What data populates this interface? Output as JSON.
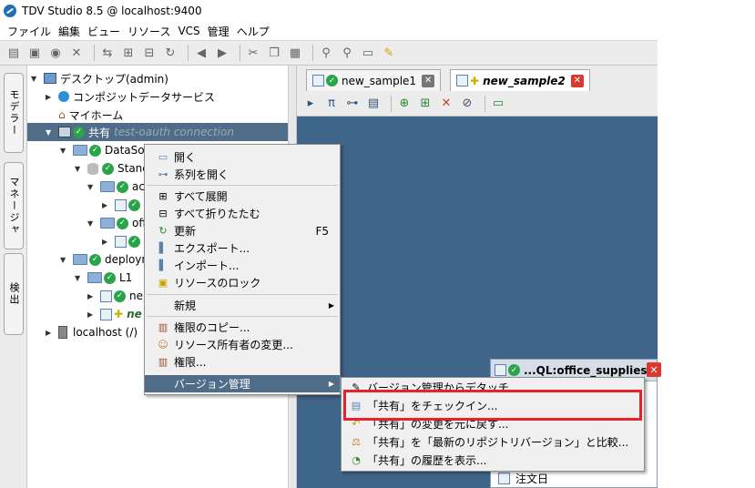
{
  "window": {
    "title": "TDV Studio 8.5 @ localhost:9400"
  },
  "menubar": [
    "ファイル",
    "編集",
    "ビュー",
    "リソース",
    "VCS",
    "管理",
    "ヘルプ"
  ],
  "left_tabs": [
    "モデラー",
    "マネージャ",
    "検出"
  ],
  "tree": [
    {
      "label": "デスクトップ(admin)"
    },
    {
      "label": "コンポジットデータサービス"
    },
    {
      "label": "マイホーム"
    },
    {
      "label": "共有",
      "extra": "test-oauth connection"
    },
    {
      "label": "DataSou"
    },
    {
      "label": "Stanc"
    },
    {
      "label": "ac"
    },
    {
      "label": ""
    },
    {
      "label": "off"
    },
    {
      "label": ""
    },
    {
      "label": "deploym"
    },
    {
      "label": "L1"
    },
    {
      "label": "ne"
    },
    {
      "label": "ne"
    },
    {
      "label": "localhost (/)"
    }
  ],
  "editor_tabs": [
    {
      "label": "new_sample1"
    },
    {
      "label": "new_sample2"
    }
  ],
  "subwindow": {
    "title": "...QL:office_supplies",
    "bottom_item": "注文日"
  },
  "context_menu": [
    {
      "label": "開く",
      "icon": "folder-open-icon"
    },
    {
      "label": "系列を開く",
      "icon": "lineage-icon"
    },
    {
      "label": "すべて展開",
      "icon": "expand-all-icon"
    },
    {
      "label": "すべて折りたたむ",
      "icon": "collapse-all-icon"
    },
    {
      "label": "更新",
      "icon": "refresh-icon",
      "shortcut": "F5"
    },
    {
      "label": "エクスポート...",
      "icon": "export-icon"
    },
    {
      "label": "インポート...",
      "icon": "import-icon"
    },
    {
      "label": "リソースのロック",
      "icon": "lock-icon"
    },
    {
      "label": "新規",
      "icon": "",
      "submenu": true
    },
    {
      "label": "権限のコピー...",
      "icon": "copy-privileges-icon"
    },
    {
      "label": "リソース所有者の変更...",
      "icon": "owner-icon"
    },
    {
      "label": "権限...",
      "icon": "privileges-icon"
    },
    {
      "label": "バージョン管理",
      "icon": "",
      "submenu": true
    }
  ],
  "version_submenu": [
    {
      "label": "バージョン管理からデタッチ...",
      "icon": "detach-icon"
    },
    {
      "label": "「共有」をチェックイン...",
      "icon": "checkin-icon"
    },
    {
      "label": "「共有」の変更を元に戻す...",
      "icon": "revert-icon"
    },
    {
      "label": "「共有」を「最新のリポジトリバージョン」と比較...",
      "icon": "compare-icon"
    },
    {
      "label": "「共有」の履歴を表示...",
      "icon": "history-icon"
    }
  ],
  "colors": {
    "selection": "#4f6c89",
    "editor_bg": "#3f6588",
    "highlight_box": "#e8222a",
    "check": "#2aa34a"
  }
}
